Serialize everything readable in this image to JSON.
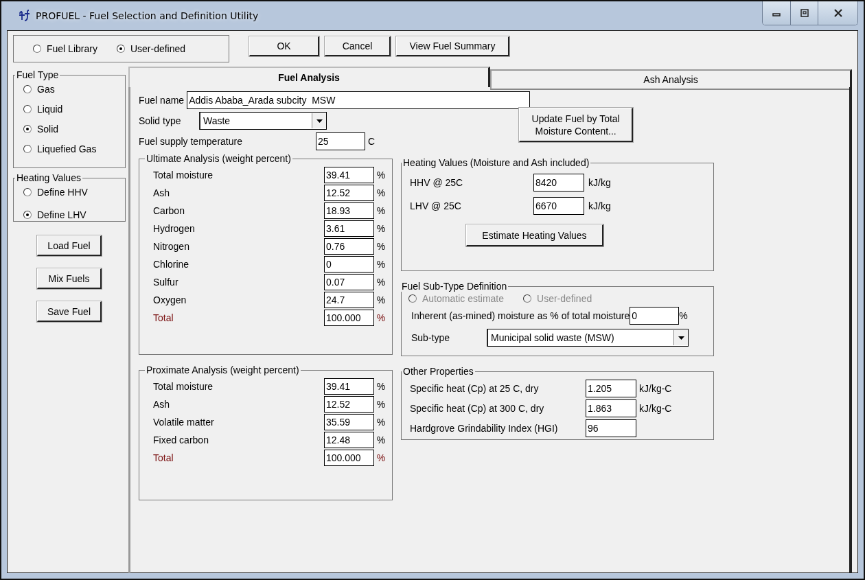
{
  "window": {
    "title": "PROFUEL - Fuel Selection and Definition Utility"
  },
  "source": [
    {
      "label": "Fuel Library",
      "selected": false
    },
    {
      "label": "User-defined",
      "selected": true
    }
  ],
  "top_buttons": [
    "OK",
    "Cancel",
    "View Fuel Summary"
  ],
  "fuel_type": {
    "title": "Fuel Type",
    "options": [
      {
        "label": "Gas",
        "selected": false
      },
      {
        "label": "Liquid",
        "selected": false
      },
      {
        "label": "Solid",
        "selected": true
      },
      {
        "label": "Liquefied Gas",
        "selected": false
      }
    ]
  },
  "heating_values_mode": {
    "title": "Heating Values",
    "options": [
      {
        "label": "Define HHV",
        "selected": false
      },
      {
        "label": "Define LHV",
        "selected": true
      }
    ]
  },
  "side_buttons": [
    "Load Fuel",
    "Mix Fuels",
    "Save Fuel"
  ],
  "tabs": [
    {
      "label": "Fuel Analysis",
      "selected": true
    },
    {
      "label": "Ash Analysis",
      "selected": false
    }
  ],
  "fuel_name": {
    "label": "Fuel name",
    "value": "Addis Ababa_Arada subcity  MSW"
  },
  "solid_type": {
    "label": "Solid type",
    "value": "Waste"
  },
  "update_button": [
    "Update Fuel by Total",
    "Moisture Content..."
  ],
  "supply_temperature": {
    "label": "Fuel supply temperature",
    "value": "25",
    "unit": "C"
  },
  "ultimate": {
    "title": "Ultimate Analysis (weight percent)",
    "rows": [
      {
        "kind": "item",
        "label": "Total moisture",
        "value": "39.41",
        "unit": "%"
      },
      {
        "kind": "item",
        "label": "Ash",
        "value": "12.52",
        "unit": "%"
      },
      {
        "kind": "item",
        "label": "Carbon",
        "value": "18.93",
        "unit": "%"
      },
      {
        "kind": "item",
        "label": "Hydrogen",
        "value": "3.61",
        "unit": "%"
      },
      {
        "kind": "item",
        "label": "Nitrogen",
        "value": "0.76",
        "unit": "%"
      },
      {
        "kind": "item",
        "label": "Chlorine",
        "value": "0",
        "unit": "%"
      },
      {
        "kind": "item",
        "label": "Sulfur",
        "value": "0.07",
        "unit": "%"
      },
      {
        "kind": "item",
        "label": "Oxygen",
        "value": "24.7",
        "unit": "%"
      },
      {
        "kind": "total",
        "label": "Total",
        "value": "100.000",
        "unit": "%"
      }
    ]
  },
  "proximate": {
    "title": "Proximate Analysis (weight percent)",
    "rows": [
      {
        "kind": "item",
        "label": "Total moisture",
        "value": "39.41",
        "unit": "%"
      },
      {
        "kind": "item",
        "label": "Ash",
        "value": "12.52",
        "unit": "%"
      },
      {
        "kind": "item",
        "label": "Volatile matter",
        "value": "35.59",
        "unit": "%"
      },
      {
        "kind": "item",
        "label": "Fixed carbon",
        "value": "12.48",
        "unit": "%"
      },
      {
        "kind": "total",
        "label": "Total",
        "value": "100.000",
        "unit": "%"
      }
    ]
  },
  "heating_values": {
    "title": "Heating Values (Moisture and Ash included)",
    "rows": [
      {
        "label": "HHV @ 25C",
        "value": "8420",
        "unit": "kJ/kg"
      },
      {
        "label": "LHV @ 25C",
        "value": "6670",
        "unit": "kJ/kg"
      }
    ],
    "button": "Estimate Heating Values"
  },
  "sub_type": {
    "title": "Fuel Sub-Type Definition",
    "options": [
      {
        "label": "Automatic estimate",
        "selected": false,
        "disabled": true
      },
      {
        "label": "User-defined",
        "selected": false,
        "disabled": true
      }
    ],
    "inherent": {
      "label": "Inherent (as-mined) moisture as % of total moisture",
      "value": "0",
      "unit": "%"
    },
    "subtype": {
      "label": "Sub-type",
      "value": "Municipal solid waste (MSW)"
    }
  },
  "other": {
    "title": "Other Properties",
    "rows": [
      {
        "label": "Specific heat (Cp) at 25 C, dry",
        "value": "1.205",
        "unit": "kJ/kg-C"
      },
      {
        "label": "Specific heat (Cp) at 300 C, dry",
        "value": "1.863",
        "unit": "kJ/kg-C"
      },
      {
        "label": "Hardgrove Grindability Index (HGI)",
        "value": "96"
      }
    ]
  }
}
